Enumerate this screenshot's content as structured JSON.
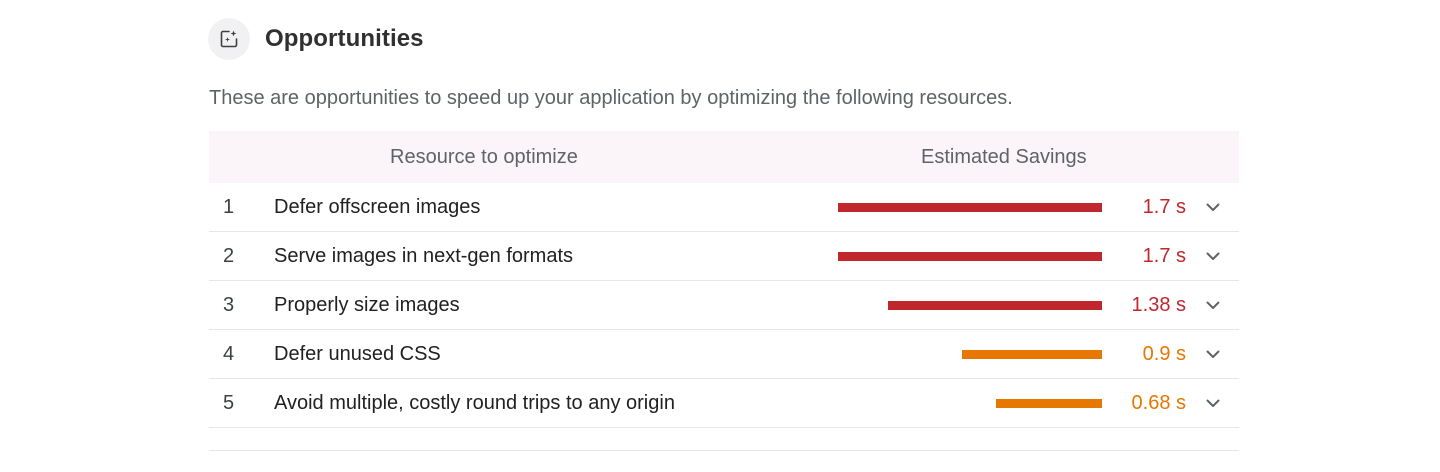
{
  "section": {
    "title": "Opportunities",
    "icon": "opportunity-icon",
    "description": "These are opportunities to speed up your application by optimizing the following resources."
  },
  "table": {
    "headers": {
      "resource": "Resource to optimize",
      "savings": "Estimated Savings"
    },
    "rows": [
      {
        "index": "1",
        "label": "Defer offscreen images",
        "value": "1.7 s",
        "savings_seconds": 1.7,
        "severity": "high",
        "expand_icon": "chevron-down-icon"
      },
      {
        "index": "2",
        "label": "Serve images in next-gen formats",
        "value": "1.7 s",
        "savings_seconds": 1.7,
        "severity": "high",
        "expand_icon": "chevron-down-icon"
      },
      {
        "index": "3",
        "label": "Properly size images",
        "value": "1.38 s",
        "savings_seconds": 1.38,
        "severity": "high",
        "expand_icon": "chevron-down-icon"
      },
      {
        "index": "4",
        "label": "Defer unused CSS",
        "value": "0.9 s",
        "savings_seconds": 0.9,
        "severity": "medium",
        "expand_icon": "chevron-down-icon"
      },
      {
        "index": "5",
        "label": "Avoid multiple, costly round trips to any origin",
        "value": "0.68 s",
        "savings_seconds": 0.68,
        "severity": "medium",
        "expand_icon": "chevron-down-icon"
      }
    ]
  },
  "colors": {
    "high": "#c0272d",
    "medium": "#e67700",
    "header_background": "#fbf5f9",
    "icon_background": "#f1f1f3"
  }
}
